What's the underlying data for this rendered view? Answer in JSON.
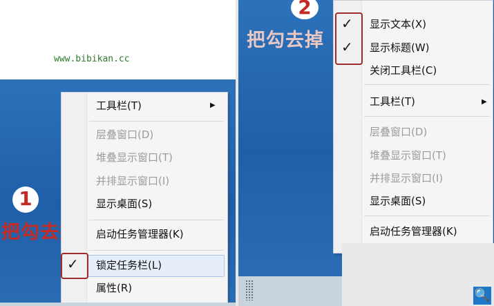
{
  "left": {
    "watermark_url": "www.bibikan.cc",
    "callout_number": "1",
    "callout_text": "把勾去掉",
    "menu": {
      "items": [
        {
          "label": "工具栏(T)"
        },
        {
          "label": "层叠窗口(D)"
        },
        {
          "label": "堆叠显示窗口(T)"
        },
        {
          "label": "并排显示窗口(I)"
        },
        {
          "label": "显示桌面(S)"
        },
        {
          "label": "启动任务管理器(K)"
        },
        {
          "label": "锁定任务栏(L)"
        },
        {
          "label": "属性(R)"
        }
      ],
      "checkmark": "✓"
    }
  },
  "right": {
    "callout_number": "2",
    "callout_text": "把勾去掉",
    "menu": {
      "items": [
        {
          "label": "显示文本(X)"
        },
        {
          "label": "显示标题(W)"
        },
        {
          "label": "关闭工具栏(C)"
        },
        {
          "label": "工具栏(T)"
        },
        {
          "label": "层叠窗口(D)"
        },
        {
          "label": "堆叠显示窗口(T)"
        },
        {
          "label": "并排显示窗口(I)"
        },
        {
          "label": "显示桌面(S)"
        },
        {
          "label": "启动任务管理器(K)"
        }
      ],
      "checkmark": "✓"
    },
    "search_icon": "🔍"
  },
  "colors": {
    "callout_red": "#c22b24",
    "desktop_blue": "#2a6db5",
    "menu_bg": "#f5f5f5"
  }
}
